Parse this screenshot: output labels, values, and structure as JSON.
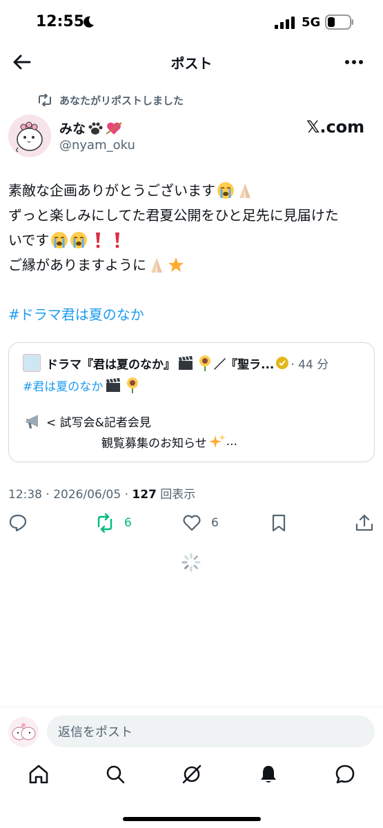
{
  "status": {
    "time": "12:55",
    "network": "5G"
  },
  "nav": {
    "title": "ポスト"
  },
  "repost": {
    "text": "あなたがリポストしました"
  },
  "author": {
    "name": "みな",
    "handle": "@nyam_oku",
    "source": "𝕏.com"
  },
  "tweet": {
    "line1": "素敵な企画ありがとうございます",
    "line2": "ずっと楽しみにしてた君夏公開をひと足先に見届けた",
    "line3": "いです",
    "line4": "ご縁がありますように",
    "hashtag": "#ドラマ君は夏のなか"
  },
  "quote": {
    "name": "ドラマ『君は夏のなか』",
    "name_suffix": "／『聖ラ...",
    "time": "· 44 分",
    "hashtag": "#君は夏のなか",
    "line3": "< 試写会&記者会見",
    "line4": "観覧募集のお知らせ",
    "line4_suffix": "..."
  },
  "meta": {
    "timestamp": "12:38 · 2026/06/05 · ",
    "views_count": "127",
    "views_label": " 回表示"
  },
  "actions": {
    "repost_count": "6",
    "like_count": "6"
  },
  "composer": {
    "placeholder": "返信をポスト"
  },
  "colors": {
    "accent": "#1d9bf0",
    "repost_green": "#00ba7c",
    "secondary_text": "#536471"
  }
}
